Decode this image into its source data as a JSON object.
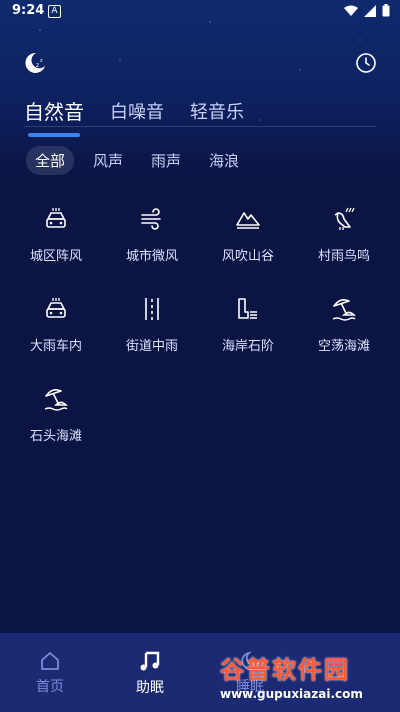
{
  "status": {
    "time": "9:24",
    "indicator": "A"
  },
  "tabs": [
    {
      "label": "自然音",
      "active": true
    },
    {
      "label": "白噪音",
      "active": false
    },
    {
      "label": "轻音乐",
      "active": false
    }
  ],
  "filters": [
    {
      "label": "全部",
      "active": true
    },
    {
      "label": "风声",
      "active": false
    },
    {
      "label": "雨声",
      "active": false
    },
    {
      "label": "海浪",
      "active": false
    }
  ],
  "sounds": [
    {
      "label": "城区阵风",
      "icon": "car-rain-icon"
    },
    {
      "label": "城市微风",
      "icon": "wind-icon"
    },
    {
      "label": "风吹山谷",
      "icon": "mountain-icon"
    },
    {
      "label": "村雨鸟鸣",
      "icon": "bird-rain-icon"
    },
    {
      "label": "大雨车内",
      "icon": "car-rain-icon"
    },
    {
      "label": "街道中雨",
      "icon": "street-icon"
    },
    {
      "label": "海岸石阶",
      "icon": "stairs-icon"
    },
    {
      "label": "空荡海滩",
      "icon": "beach-icon"
    },
    {
      "label": "石头海滩",
      "icon": "beach-icon"
    }
  ],
  "nav": [
    {
      "label": "首页",
      "icon": "home-icon",
      "active": false
    },
    {
      "label": "助眠",
      "icon": "music-icon",
      "active": true
    },
    {
      "label": "睡眠",
      "icon": "sleep-icon",
      "active": false
    }
  ],
  "watermark": {
    "title": "谷普软件园",
    "url": "www.gupuxiazai.com"
  },
  "colors": {
    "accent": "#3b82f6",
    "background": "#0b1443",
    "nav_bg": "#1b2a73"
  }
}
